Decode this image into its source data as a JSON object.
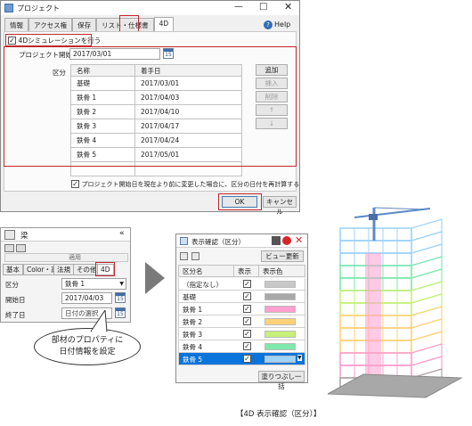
{
  "dialog": {
    "title": "プロジェクト",
    "window_controls": {
      "minimize": "—",
      "maximize": "□",
      "close": "✕"
    },
    "tabs": [
      "情報",
      "アクセス権",
      "保存",
      "リスト・仕様書",
      "4D"
    ],
    "help_label": "Help",
    "simulation_checkbox_label": "4Dシミュレーションを行う",
    "start_date_label": "プロジェクト開始日",
    "start_date_value": "2017/03/01",
    "calendar_icon_text": "15",
    "section_label": "区分",
    "table_headers": [
      "名称",
      "着手日"
    ],
    "rows": [
      {
        "name": "基礎",
        "date": "2017/03/01"
      },
      {
        "name": "鉄骨 1",
        "date": "2017/04/03"
      },
      {
        "name": "鉄骨 2",
        "date": "2017/04/10"
      },
      {
        "name": "鉄骨 3",
        "date": "2017/04/17"
      },
      {
        "name": "鉄骨 4",
        "date": "2017/04/24"
      },
      {
        "name": "鉄骨 5",
        "date": "2017/05/01"
      }
    ],
    "side_buttons": {
      "add": "追加",
      "insert": "挿入",
      "delete": "削除",
      "up": "↑",
      "down": "↓"
    },
    "recalc_checkbox_label": "プロジェクト開始日を現在より前に変更した場合に、区分の日付を再計算する",
    "ok_label": "OK",
    "cancel_label": "キャンセル"
  },
  "property_panel": {
    "title": "梁",
    "collapse_glyph": "«",
    "apply_label": "適用",
    "tabs": [
      "基本",
      "Color・高",
      "法規",
      "その他",
      "4D"
    ],
    "section_label": "区分",
    "section_value": "鉄骨 1",
    "start_label": "開始日",
    "start_value": "2017/04/03",
    "end_label": "終了日",
    "end_value": "日付の選択",
    "calendar_icon_text": "15"
  },
  "callout_text": [
    "部材のプロパティに",
    "日付情報を設定"
  ],
  "display_window": {
    "title": "表示確認（区分）",
    "view_update_label": "ビュー更新",
    "headers": [
      "区分名",
      "表示",
      "表示色"
    ],
    "rows": [
      {
        "name": "（指定なし）",
        "color": "#c8c8c8",
        "selected": false
      },
      {
        "name": "基礎",
        "color": "#a8a8a8",
        "selected": false
      },
      {
        "name": "鉄骨 1",
        "color": "#ff9fcf",
        "selected": false
      },
      {
        "name": "鉄骨 2",
        "color": "#ffd27a",
        "selected": false
      },
      {
        "name": "鉄骨 3",
        "color": "#c6f07a",
        "selected": false
      },
      {
        "name": "鉄骨 4",
        "color": "#7fe9ad",
        "selected": false
      },
      {
        "name": "鉄骨 5",
        "color": "#9fd3f7",
        "selected": true
      }
    ],
    "fill_all_label": "塗りつぶし一括"
  },
  "caption": "【4D 表示確認（区分）】",
  "colors": {
    "highlight_red": "#c0282e",
    "selection_blue": "#0a74da",
    "accent_blue": "#2f6db5"
  }
}
